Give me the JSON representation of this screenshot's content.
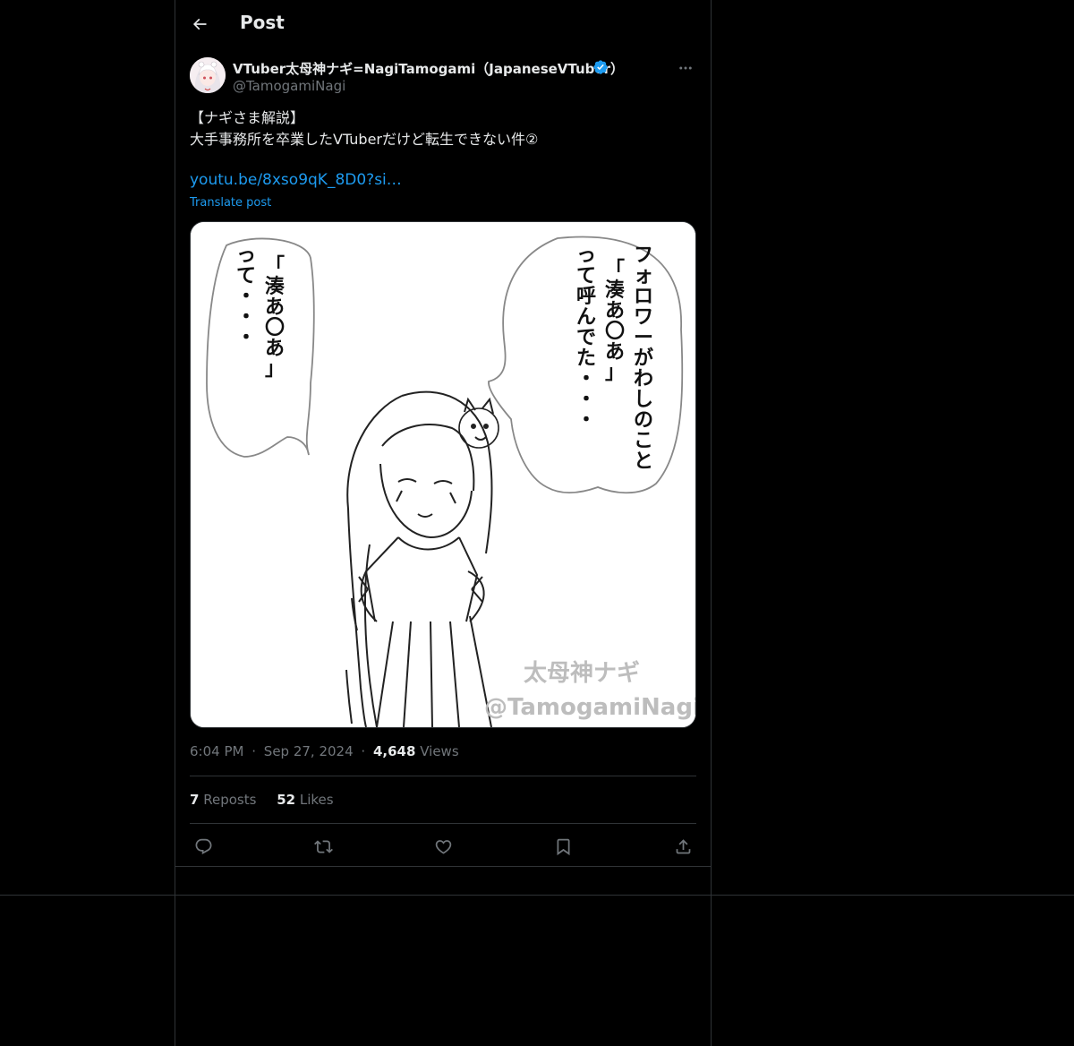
{
  "header": {
    "title": "Post"
  },
  "author": {
    "display_name": "VTuber太母神ナギ=NagiTamogami（JapaneseVTuber）",
    "handle": "@TamogamiNagi"
  },
  "post": {
    "line1": "【ナギさま解説】",
    "line2": "大手事務所を卒業したVTuberだけど転生できない件②",
    "link_text": "youtu.be/8xso9qK_8D0?si…",
    "translate_label": "Translate post"
  },
  "media": {
    "bubble_right": [
      "フォロワーがわしのこと",
      "「湊あ〇あ」",
      "って呼んでた・・・"
    ],
    "bubble_left": [
      "「湊あ〇あ」",
      "って・・・"
    ],
    "watermark_line1": "太母神ナギ",
    "watermark_line2": "@TamogamiNagi"
  },
  "meta": {
    "time": "6:04 PM",
    "sep": "·",
    "date": "Sep 27, 2024",
    "views_count": "4,648",
    "views_label": "Views"
  },
  "stats": {
    "reposts_count": "7",
    "reposts_label": "Reposts",
    "likes_count": "52",
    "likes_label": "Likes"
  },
  "colors": {
    "background": "#000000",
    "text": "#e7e9ea",
    "muted": "#71767b",
    "accent": "#1d9bf0",
    "border": "#2f3336"
  },
  "icons": {
    "back": "arrow-left-icon",
    "verified": "verified-badge-icon",
    "more": "more-horizontal-icon",
    "reply": "reply-icon",
    "repost": "repost-icon",
    "like": "heart-icon",
    "bookmark": "bookmark-icon",
    "share": "share-icon"
  }
}
